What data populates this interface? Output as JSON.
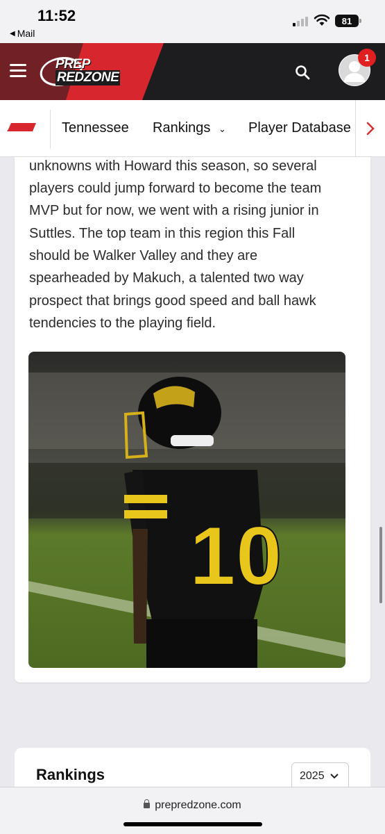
{
  "status_bar": {
    "time": "11:52",
    "back_label": "Mail",
    "battery": "81"
  },
  "header": {
    "logo_line1": "PREP",
    "logo_line2": "REDZONE",
    "notification_count": "1",
    "accent_color": "#d7262e"
  },
  "subnav": {
    "items": [
      {
        "label": "Tennessee"
      },
      {
        "label": "Rankings"
      },
      {
        "label": "Player Database"
      }
    ]
  },
  "article": {
    "lines": [
      "unknowns with Howard this season, so several",
      "players could jump forward to become the team",
      "MVP but for now, we went with a rising junior in",
      "Suttles. The top team in this region this Fall",
      "should be Walker Valley and they are",
      "spearheaded by Makuch, a talented two way",
      "prospect that brings good speed and ball hawk",
      "tendencies to the playing field."
    ],
    "jersey_number": "10"
  },
  "rankings": {
    "title": "Rankings",
    "year": "2025"
  },
  "browser": {
    "url": "prepredzone.com"
  }
}
